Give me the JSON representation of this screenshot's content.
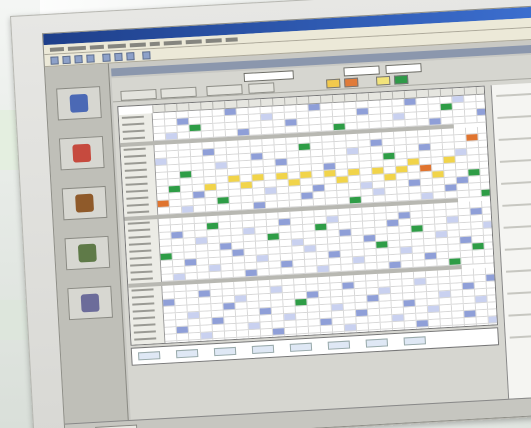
{
  "window": {
    "title": "",
    "document_title": ""
  },
  "menu": {
    "items": [
      "",
      "",
      "",
      "",
      "",
      "",
      "",
      "",
      "",
      ""
    ]
  },
  "toolbar": {
    "icons": [
      "new-icon",
      "open-icon",
      "save-icon",
      "print-icon",
      "cut-icon",
      "copy-icon",
      "paste-icon",
      "undo-icon"
    ]
  },
  "filters": {
    "field1_value": "",
    "field2_value": "",
    "field3_value": ""
  },
  "tabs": [
    "",
    "",
    "",
    ""
  ],
  "legend": {
    "chips": [
      {
        "color": "#f2c94c"
      },
      {
        "color": "#e07b3a"
      },
      {
        "color": "#f2e37a"
      },
      {
        "color": "#2f9a48"
      }
    ]
  },
  "sidebar": {
    "icons": [
      "people-icon",
      "clock-icon",
      "tools-icon",
      "calendar-icon",
      "report-icon"
    ]
  },
  "grid": {
    "cols": 28,
    "rows": 32,
    "colors": {
      "empty": "#ffffff",
      "blue": "#8f9fd8",
      "light_blue": "#c9d1f0",
      "green": "#2e9d46",
      "yellow": "#f1d44a",
      "orange": "#e0742f"
    },
    "cells": [
      [
        0,
        6,
        "blue"
      ],
      [
        0,
        13,
        "blue"
      ],
      [
        0,
        21,
        "blue"
      ],
      [
        0,
        25,
        "light_blue"
      ],
      [
        1,
        2,
        "blue"
      ],
      [
        1,
        9,
        "light_blue"
      ],
      [
        1,
        17,
        "blue"
      ],
      [
        1,
        24,
        "green"
      ],
      [
        2,
        3,
        "green"
      ],
      [
        2,
        11,
        "blue"
      ],
      [
        2,
        20,
        "light_blue"
      ],
      [
        2,
        27,
        "blue"
      ],
      [
        3,
        1,
        "light_blue"
      ],
      [
        3,
        7,
        "blue"
      ],
      [
        3,
        15,
        "green"
      ],
      [
        3,
        23,
        "blue"
      ],
      [
        5,
        4,
        "blue"
      ],
      [
        5,
        12,
        "green"
      ],
      [
        5,
        18,
        "blue"
      ],
      [
        5,
        26,
        "orange"
      ],
      [
        6,
        0,
        "light_blue"
      ],
      [
        6,
        8,
        "blue"
      ],
      [
        6,
        16,
        "light_blue"
      ],
      [
        6,
        22,
        "blue"
      ],
      [
        7,
        5,
        "light_blue"
      ],
      [
        7,
        10,
        "blue"
      ],
      [
        7,
        19,
        "green"
      ],
      [
        7,
        25,
        "light_blue"
      ],
      [
        8,
        2,
        "green"
      ],
      [
        8,
        14,
        "blue"
      ],
      [
        8,
        21,
        "yellow"
      ],
      [
        8,
        24,
        "yellow"
      ],
      [
        9,
        6,
        "yellow"
      ],
      [
        9,
        8,
        "yellow"
      ],
      [
        9,
        10,
        "yellow"
      ],
      [
        9,
        12,
        "yellow"
      ],
      [
        9,
        14,
        "yellow"
      ],
      [
        9,
        16,
        "yellow"
      ],
      [
        9,
        18,
        "yellow"
      ],
      [
        9,
        20,
        "yellow"
      ],
      [
        9,
        22,
        "orange"
      ],
      [
        10,
        1,
        "green"
      ],
      [
        10,
        4,
        "yellow"
      ],
      [
        10,
        7,
        "yellow"
      ],
      [
        10,
        11,
        "yellow"
      ],
      [
        10,
        15,
        "yellow"
      ],
      [
        10,
        19,
        "yellow"
      ],
      [
        10,
        23,
        "yellow"
      ],
      [
        10,
        26,
        "green"
      ],
      [
        11,
        3,
        "blue"
      ],
      [
        11,
        9,
        "light_blue"
      ],
      [
        11,
        13,
        "blue"
      ],
      [
        11,
        17,
        "light_blue"
      ],
      [
        11,
        21,
        "blue"
      ],
      [
        11,
        25,
        "blue"
      ],
      [
        12,
        0,
        "orange"
      ],
      [
        12,
        5,
        "green"
      ],
      [
        12,
        12,
        "blue"
      ],
      [
        12,
        18,
        "light_blue"
      ],
      [
        12,
        24,
        "blue"
      ],
      [
        13,
        2,
        "light_blue"
      ],
      [
        13,
        8,
        "blue"
      ],
      [
        13,
        16,
        "green"
      ],
      [
        13,
        22,
        "light_blue"
      ],
      [
        13,
        27,
        "green"
      ],
      [
        15,
        4,
        "green"
      ],
      [
        15,
        10,
        "blue"
      ],
      [
        15,
        14,
        "light_blue"
      ],
      [
        15,
        20,
        "blue"
      ],
      [
        15,
        26,
        "blue"
      ],
      [
        16,
        1,
        "blue"
      ],
      [
        16,
        7,
        "light_blue"
      ],
      [
        16,
        13,
        "green"
      ],
      [
        16,
        19,
        "blue"
      ],
      [
        16,
        24,
        "light_blue"
      ],
      [
        17,
        3,
        "light_blue"
      ],
      [
        17,
        9,
        "green"
      ],
      [
        17,
        15,
        "blue"
      ],
      [
        17,
        21,
        "green"
      ],
      [
        17,
        27,
        "light_blue"
      ],
      [
        18,
        5,
        "blue"
      ],
      [
        18,
        11,
        "light_blue"
      ],
      [
        18,
        17,
        "blue"
      ],
      [
        18,
        23,
        "light_blue"
      ],
      [
        19,
        0,
        "green"
      ],
      [
        19,
        6,
        "blue"
      ],
      [
        19,
        12,
        "light_blue"
      ],
      [
        19,
        18,
        "green"
      ],
      [
        19,
        25,
        "blue"
      ],
      [
        20,
        2,
        "blue"
      ],
      [
        20,
        8,
        "light_blue"
      ],
      [
        20,
        14,
        "blue"
      ],
      [
        20,
        20,
        "light_blue"
      ],
      [
        20,
        26,
        "green"
      ],
      [
        21,
        4,
        "light_blue"
      ],
      [
        21,
        10,
        "blue"
      ],
      [
        21,
        16,
        "light_blue"
      ],
      [
        21,
        22,
        "blue"
      ],
      [
        22,
        1,
        "light_blue"
      ],
      [
        22,
        7,
        "blue"
      ],
      [
        22,
        13,
        "light_blue"
      ],
      [
        22,
        19,
        "blue"
      ],
      [
        22,
        24,
        "green"
      ],
      [
        24,
        3,
        "blue"
      ],
      [
        24,
        9,
        "light_blue"
      ],
      [
        24,
        15,
        "blue"
      ],
      [
        24,
        21,
        "light_blue"
      ],
      [
        24,
        27,
        "blue"
      ],
      [
        25,
        0,
        "blue"
      ],
      [
        25,
        6,
        "light_blue"
      ],
      [
        25,
        12,
        "blue"
      ],
      [
        25,
        18,
        "light_blue"
      ],
      [
        25,
        25,
        "blue"
      ],
      [
        26,
        5,
        "blue"
      ],
      [
        26,
        11,
        "green"
      ],
      [
        26,
        17,
        "blue"
      ],
      [
        26,
        23,
        "light_blue"
      ],
      [
        27,
        2,
        "light_blue"
      ],
      [
        27,
        8,
        "blue"
      ],
      [
        27,
        14,
        "light_blue"
      ],
      [
        27,
        20,
        "blue"
      ],
      [
        27,
        26,
        "light_blue"
      ],
      [
        28,
        4,
        "blue"
      ],
      [
        28,
        10,
        "light_blue"
      ],
      [
        28,
        16,
        "blue"
      ],
      [
        28,
        22,
        "light_blue"
      ],
      [
        29,
        1,
        "blue"
      ],
      [
        29,
        7,
        "light_blue"
      ],
      [
        29,
        13,
        "blue"
      ],
      [
        29,
        19,
        "light_blue"
      ],
      [
        29,
        25,
        "blue"
      ],
      [
        30,
        3,
        "light_blue"
      ],
      [
        30,
        9,
        "blue"
      ],
      [
        30,
        15,
        "light_blue"
      ],
      [
        30,
        21,
        "blue"
      ],
      [
        30,
        27,
        "light_blue"
      ]
    ],
    "band_rows": [
      4,
      14,
      23
    ]
  },
  "summary": {
    "values": [
      "",
      "",
      "",
      "",
      "",
      "",
      "",
      ""
    ]
  },
  "right_panel": {
    "lines": 12
  },
  "status": {
    "button_label": ""
  }
}
